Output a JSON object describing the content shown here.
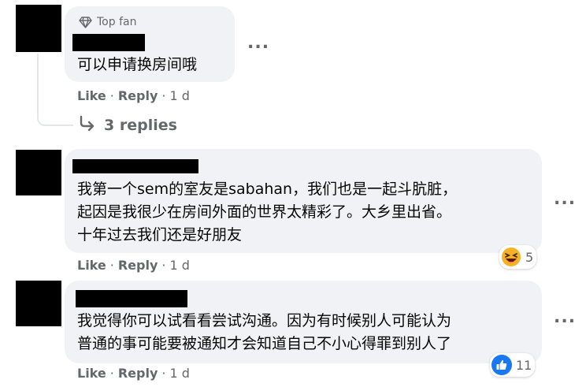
{
  "comments": [
    {
      "badge": "Top fan",
      "text_lines": [
        "可以申请换房间哦"
      ],
      "actions": {
        "like": "Like",
        "reply": "Reply",
        "time": "1 d"
      },
      "replies_label": "3 replies"
    },
    {
      "text_lines": [
        "我第一个sem的室友是sabahan，我们也是一起斗肮脏，",
        "起因是我很少在房间外面的世界太精彩了。大乡里出省。",
        "十年过去我们还是好朋友"
      ],
      "actions": {
        "like": "Like",
        "reply": "Reply",
        "time": "1 d"
      },
      "reaction": {
        "icon": "laughing-emoji-icon",
        "count": "5"
      }
    },
    {
      "text_lines": [
        "我觉得你可以试看看尝试沟通。因为有时候别人可能认为",
        "普通的事可能要被通知才会知道自己不小心得罪到别人了"
      ],
      "actions": {
        "like": "Like",
        "reply": "Reply",
        "time": "1 d"
      },
      "reaction": {
        "icon": "like-thumb-icon",
        "count": "11"
      }
    }
  ],
  "more_menu": "...",
  "separator": "·",
  "colors": {
    "bubble": "#f0f2f5",
    "secondary_text": "#65676b",
    "like_blue": "#1877f2",
    "haha_yellow": "#f7b125"
  }
}
